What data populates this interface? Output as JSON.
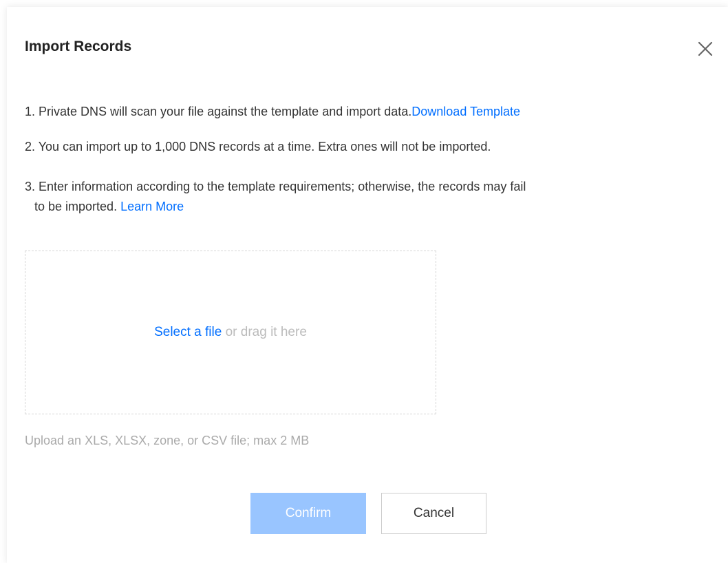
{
  "dialog": {
    "title": "Import Records",
    "close_icon": "close-icon"
  },
  "instructions": {
    "line1_text": "1. Private DNS will scan your file against the template and import data.",
    "line1_link": "Download Template",
    "line2_text": "2. You can import up to 1,000 DNS records at a time. Extra ones will not be imported.",
    "line3_text": "3. Enter information according to the template requirements; otherwise, the records may fail",
    "line4_text": "to be imported.",
    "line4_link": "Learn More"
  },
  "upload": {
    "select_link": "Select a file",
    "drag_text": "or drag it here",
    "hint": "Upload an XLS, XLSX, zone, or CSV file; max 2 MB"
  },
  "buttons": {
    "confirm": "Confirm",
    "cancel": "Cancel"
  },
  "colors": {
    "link": "#006eff",
    "confirm_disabled_bg": "#99c5ff",
    "hint_text": "#aaaaaa",
    "dashed_border": "#d5d5d5"
  }
}
